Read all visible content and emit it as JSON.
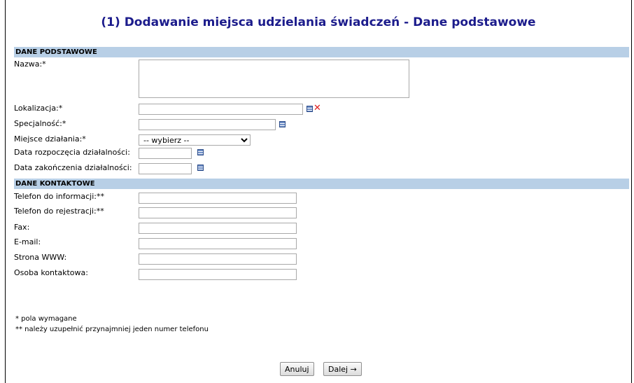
{
  "title": "(1) Dodawanie miejsca udzielania świadczeń - Dane podstawowe",
  "sections": {
    "basic": "DANE PODSTAWOWE",
    "contact": "DANE KONTAKTOWE"
  },
  "fields": {
    "nazwa": {
      "label": "Nazwa:*",
      "value": ""
    },
    "lokalizacja": {
      "label": "Lokalizacja:*",
      "value": ""
    },
    "specjalnosc": {
      "label": "Specjalność:*",
      "value": ""
    },
    "miejsce": {
      "label": "Miejsce działania:*",
      "selected": "-- wybierz --"
    },
    "data_rozpoczecia": {
      "label": "Data rozpoczęcia działalności:",
      "value": ""
    },
    "data_zakonczenia": {
      "label": "Data zakończenia działalności:",
      "value": ""
    },
    "tel_info": {
      "label": "Telefon do informacji:**",
      "value": ""
    },
    "tel_rej": {
      "label": "Telefon do rejestracji:**",
      "value": ""
    },
    "fax": {
      "label": "Fax:",
      "value": ""
    },
    "email": {
      "label": "E-mail:",
      "value": ""
    },
    "www": {
      "label": "Strona WWW:",
      "value": ""
    },
    "osoba": {
      "label": "Osoba kontaktowa:",
      "value": ""
    }
  },
  "notes": {
    "required": "*  pola wymagane",
    "phone": "** należy uzupełnić przynajmniej jeden numer telefonu"
  },
  "buttons": {
    "cancel": "Anuluj",
    "next": "Dalej →"
  },
  "icons": {
    "list": "list-picker-icon",
    "clear": "clear-x-icon"
  },
  "colors": {
    "title": "#1c1c8c",
    "section_bg": "#b8cfe6",
    "clear_icon": "#e02020"
  }
}
